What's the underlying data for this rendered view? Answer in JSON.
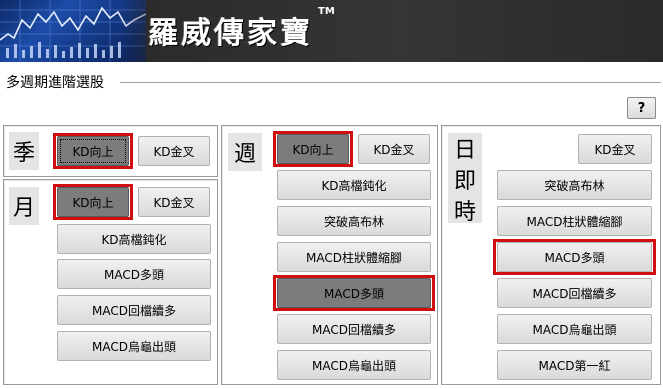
{
  "banner": {
    "title": "羅威傳家寶",
    "tm": "TM"
  },
  "group": {
    "title": "多週期進階選股",
    "help_label": "?"
  },
  "season": {
    "label": "季",
    "buttons": [
      "KD向上",
      "KD金叉"
    ]
  },
  "month": {
    "label": "月",
    "buttons": [
      "KD向上",
      "KD金叉",
      "KD高檔鈍化",
      "MACD多頭",
      "MACD回檔續多",
      "MACD烏龜出頭"
    ]
  },
  "week": {
    "label": "週",
    "buttons": [
      "KD向上",
      "KD金叉",
      "KD高檔鈍化",
      "突破高布林",
      "MACD柱狀體縮腳",
      "MACD多頭",
      "MACD回檔續多",
      "MACD烏龜出頭"
    ]
  },
  "day": {
    "label_chars": [
      "日",
      "即",
      "時"
    ],
    "buttons": [
      "KD金叉",
      "突破高布林",
      "MACD柱狀體縮腳",
      "MACD多頭",
      "MACD回檔續多",
      "MACD烏龜出頭",
      "MACD第一紅"
    ]
  },
  "state": {
    "active": [
      "season-kd-up",
      "month-kd-up",
      "week-kd-up",
      "week-macd-bull"
    ],
    "highlighted": [
      "season-kd-up",
      "month-kd-up",
      "week-kd-up",
      "week-macd-bull",
      "day-macd-bull"
    ],
    "highlight_color": "#d01010"
  }
}
